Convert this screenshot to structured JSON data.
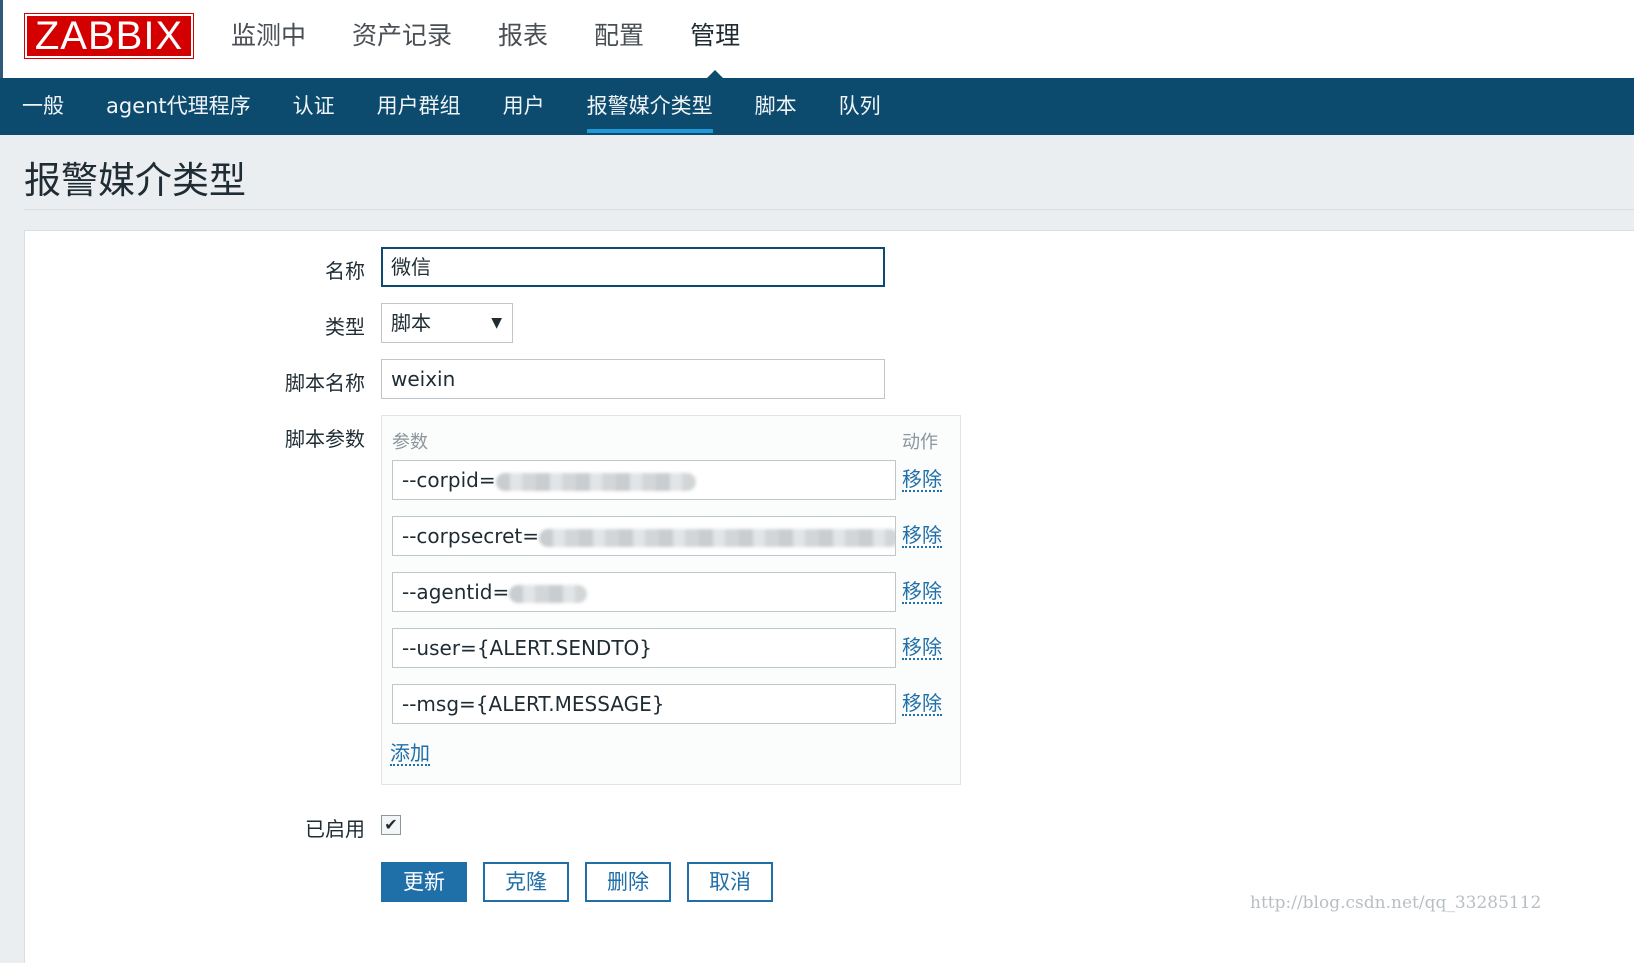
{
  "header": {
    "logo": "ZABBIX",
    "menu": [
      {
        "label": "监测中",
        "active": false
      },
      {
        "label": "资产记录",
        "active": false
      },
      {
        "label": "报表",
        "active": false
      },
      {
        "label": "配置",
        "active": false
      },
      {
        "label": "管理",
        "active": true
      }
    ]
  },
  "subnav": [
    {
      "label": "一般"
    },
    {
      "label": "agent代理程序"
    },
    {
      "label": "认证"
    },
    {
      "label": "用户群组"
    },
    {
      "label": "用户"
    },
    {
      "label": "报警媒介类型",
      "active": true
    },
    {
      "label": "脚本"
    },
    {
      "label": "队列"
    }
  ],
  "page": {
    "title": "报警媒介类型"
  },
  "form": {
    "name_label": "名称",
    "name_value": "微信",
    "type_label": "类型",
    "type_value": "脚本",
    "script_name_label": "脚本名称",
    "script_name_value": "weixin",
    "script_params_label": "脚本参数",
    "params_header": "参数",
    "action_header": "动作",
    "params": [
      {
        "prefix": "--corpid=",
        "redacted": true,
        "remove_label": "移除"
      },
      {
        "prefix": "--corpsecret=",
        "redacted": true,
        "remove_label": "移除"
      },
      {
        "prefix": "--agentid=",
        "redacted": true,
        "remove_label": "移除"
      },
      {
        "prefix": "--user={ALERT.SENDTO}",
        "redacted": false,
        "remove_label": "移除"
      },
      {
        "prefix": "--msg={ALERT.MESSAGE}",
        "redacted": false,
        "remove_label": "移除"
      }
    ],
    "add_label": "添加",
    "enabled_label": "已启用",
    "enabled": true,
    "enabled_mark": "✔"
  },
  "buttons": {
    "update": "更新",
    "clone": "克隆",
    "delete": "删除",
    "cancel": "取消"
  },
  "watermark": "http://blog.csdn.net/qq_33285112",
  "colors": {
    "logo_red": "#d40000",
    "nav_blue": "#0c4a6e",
    "link_blue": "#1f6fa8",
    "active_underline": "#1f9ad6"
  }
}
